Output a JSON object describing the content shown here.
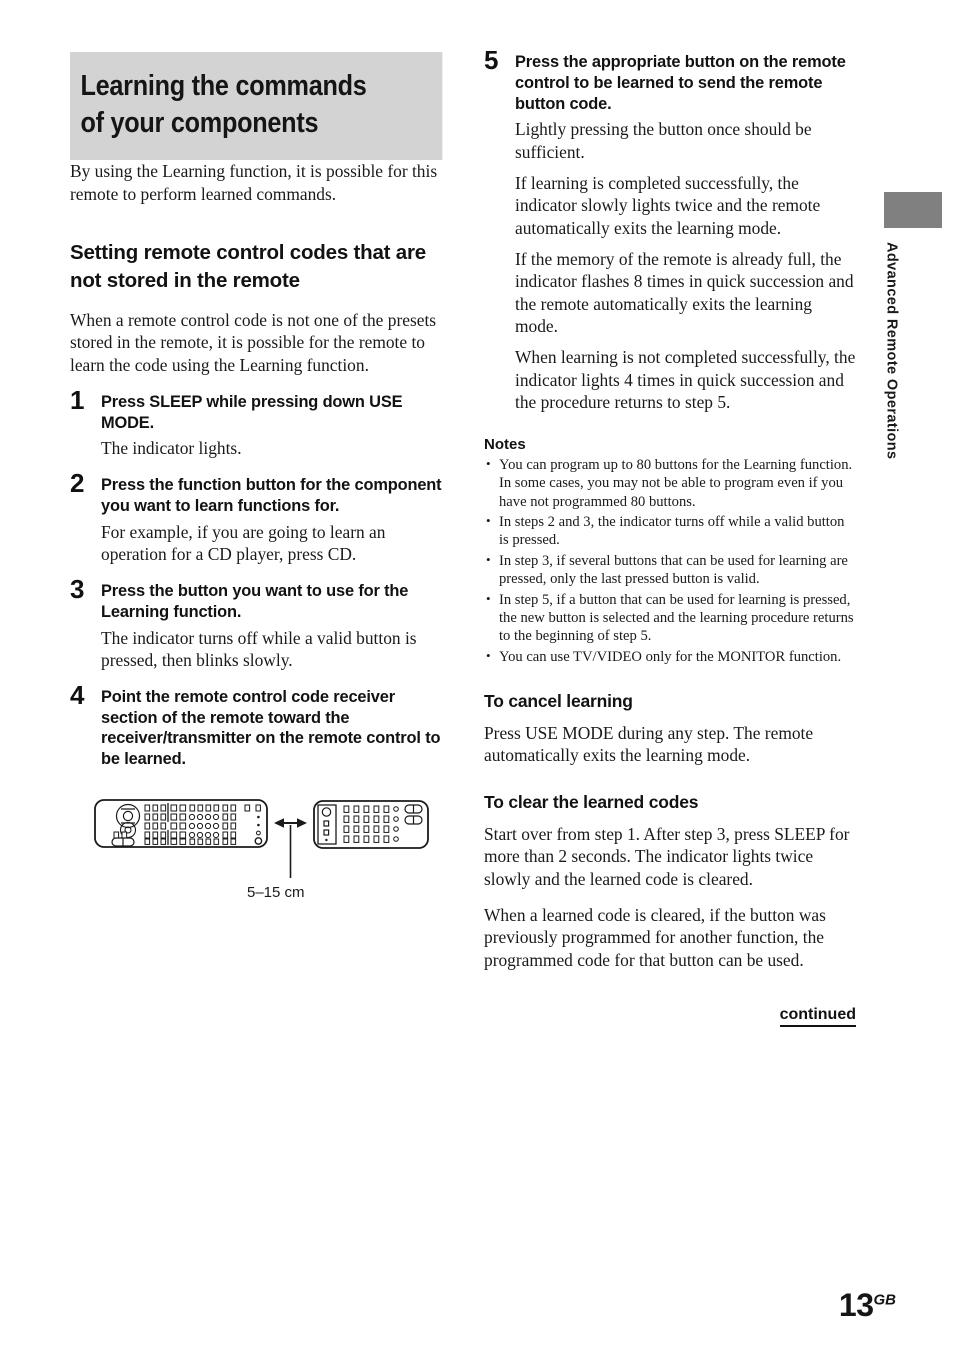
{
  "chapter": {
    "title_line1": "Learning the commands",
    "title_line2": "of your components",
    "intro": "By using the Learning function, it is possible for this remote to perform learned commands."
  },
  "section": {
    "heading": "Setting remote control codes that are not stored in the remote",
    "intro": "When a remote control code is not one of the presets stored in the remote, it is possible for the remote to learn the code using the Learning function."
  },
  "steps": [
    {
      "num": "1",
      "title": "Press SLEEP while pressing down USE MODE.",
      "body": "The indicator lights."
    },
    {
      "num": "2",
      "title": "Press the function button for the component you want to learn functions for.",
      "body": "For example, if you are going to learn an operation for a CD player, press CD."
    },
    {
      "num": "3",
      "title": "Press the button you want to use for the Learning function.",
      "body": "The indicator turns off while a valid button is pressed, then blinks slowly."
    },
    {
      "num": "4",
      "title": "Point the remote control code receiver section of the remote toward the receiver/transmitter on the remote control to be learned.",
      "body": ""
    },
    {
      "num": "5",
      "title": "Press the appropriate button on the remote control to be learned to send the remote button code.",
      "body": "Lightly pressing the button once should be sufficient.",
      "body2": "If learning is completed successfully, the indicator slowly lights twice and the remote automatically exits the learning mode.",
      "body3": "If the memory of the remote is already full, the indicator flashes 8 times in quick succession and the remote automatically exits the learning mode.",
      "body4": "When learning is not completed successfully, the indicator lights 4 times in quick succession and the procedure returns to step 5."
    }
  ],
  "figure": {
    "caption": "5–15 cm",
    "left_device": "learning-remote-illustration",
    "right_device": "source-remote-illustration",
    "arrow": "double-headed-arrow"
  },
  "notes": {
    "heading": "Notes",
    "items": [
      "You can program up to 80 buttons for the Learning function. In some cases, you may not be able to program even if you have not programmed 80 buttons.",
      "In steps 2 and 3, the indicator turns off while a valid button is pressed.",
      "In step 3, if several buttons that can be used for learning are pressed, only the last pressed button is valid.",
      "In step 5, if a button that can be used for learning is pressed, the new button is selected and the learning procedure returns to the beginning of step 5.",
      "You can use TV/VIDEO only for the MONITOR function."
    ]
  },
  "cancel_section": {
    "heading": "To cancel learning",
    "body": "Press USE MODE during any step. The remote automatically exits the learning mode."
  },
  "clear_section": {
    "heading": "To clear the learned codes",
    "body1": "Start over from step 1. After step 3, press SLEEP for more than 2 seconds. The indicator lights twice slowly and the learned code is cleared.",
    "body2": "When a learned code is cleared, if the button was previously programmed for another function, the programmed code for that button can be used."
  },
  "footer": {
    "continued": "continued",
    "page_number": "13",
    "page_suffix": "GB"
  },
  "side_tab": {
    "label": "Advanced Remote Operations",
    "bar_color": "#808080"
  },
  "colors": {
    "title_background": "#d3d3d3",
    "text": "#1a1a1a"
  }
}
